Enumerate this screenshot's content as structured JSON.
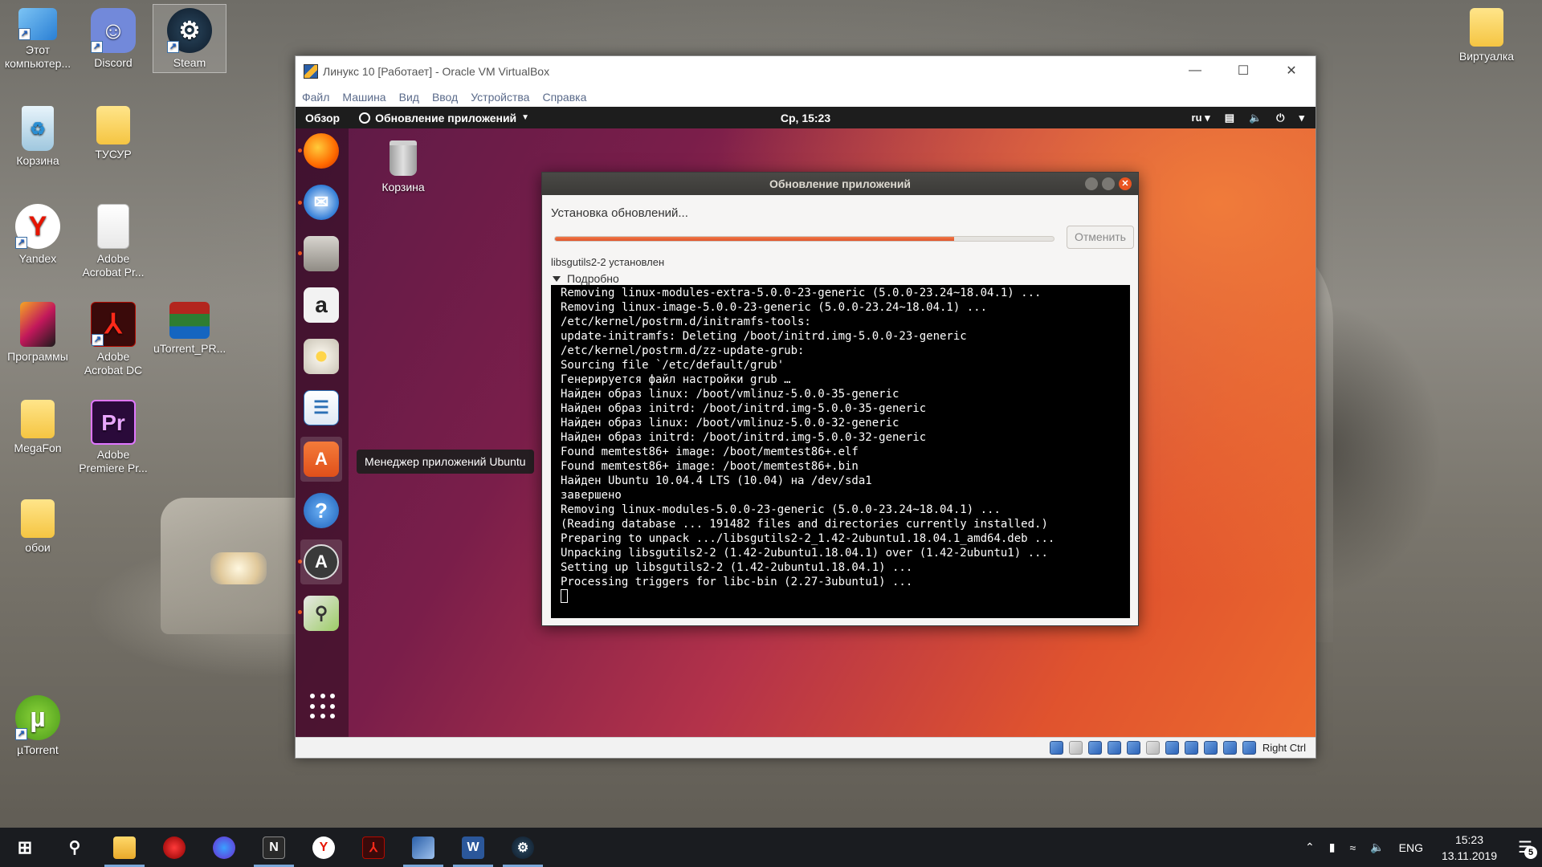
{
  "desktop": {
    "icons": [
      {
        "label": "Этот компьютер...",
        "icon": "computer-icon"
      },
      {
        "label": "Discord",
        "icon": "discord-icon"
      },
      {
        "label": "Steam",
        "icon": "steam-icon"
      },
      {
        "label": "Корзина",
        "icon": "recycle-bin-icon"
      },
      {
        "label": "ТУСУР",
        "icon": "folder-icon"
      },
      {
        "label": "Yandex",
        "icon": "yandex-browser-icon"
      },
      {
        "label": "Adobe Acrobat Pr...",
        "icon": "file-icon"
      },
      {
        "label": "Программы",
        "icon": "programs-icon"
      },
      {
        "label": "Adobe Acrobat DC",
        "icon": "acrobat-icon"
      },
      {
        "label": "uTorrent_PR...",
        "icon": "winrar-icon"
      },
      {
        "label": "MegaFon",
        "icon": "folder-icon"
      },
      {
        "label": "Adobe Premiere Pr...",
        "icon": "premiere-icon"
      },
      {
        "label": "обои",
        "icon": "folder-icon"
      },
      {
        "label": "µTorrent",
        "icon": "utorrent-icon"
      },
      {
        "label": "Виртуалка",
        "icon": "folder-icon"
      }
    ]
  },
  "vbox": {
    "title": "Линукс 10 [Работает] - Oracle VM VirtualBox",
    "menu": [
      "Файл",
      "Машина",
      "Вид",
      "Ввод",
      "Устройства",
      "Справка"
    ],
    "host_key": "Right Ctrl"
  },
  "ubuntu": {
    "topbar": {
      "overview": "Обзор",
      "app_menu": "Обновление приложений",
      "clock": "Ср, 15:23",
      "lang": "ru"
    },
    "trash_label": "Корзина",
    "tooltip": "Менеджер приложений Ubuntu",
    "dock_items": [
      "firefox-icon",
      "thunderbird-icon",
      "files-icon",
      "amazon-icon",
      "rhythmbox-icon",
      "writer-icon",
      "software-center-icon",
      "help-icon",
      "software-updater-icon",
      "image-viewer-icon"
    ]
  },
  "dialog": {
    "title": "Обновление приложений",
    "status": "Установка обновлений...",
    "progress": 0.8,
    "cancel_label": "Отменить",
    "package_status": "libsgutils2-2 установлен",
    "details_label": "Подробно",
    "terminal_lines": [
      "Removing linux-modules-extra-5.0.0-23-generic (5.0.0-23.24~18.04.1) ...",
      "Removing linux-image-5.0.0-23-generic (5.0.0-23.24~18.04.1) ...",
      "/etc/kernel/postrm.d/initramfs-tools:",
      "update-initramfs: Deleting /boot/initrd.img-5.0.0-23-generic",
      "/etc/kernel/postrm.d/zz-update-grub:",
      "Sourcing file `/etc/default/grub'",
      "Генерируется файл настройки grub …",
      "Найден образ linux: /boot/vmlinuz-5.0.0-35-generic",
      "Найден образ initrd: /boot/initrd.img-5.0.0-35-generic",
      "Найден образ linux: /boot/vmlinuz-5.0.0-32-generic",
      "Найден образ initrd: /boot/initrd.img-5.0.0-32-generic",
      "Found memtest86+ image: /boot/memtest86+.elf",
      "Found memtest86+ image: /boot/memtest86+.bin",
      "Найден Ubuntu 10.04.4 LTS (10.04) на /dev/sda1",
      "завершено",
      "Removing linux-modules-5.0.0-23-generic (5.0.0-23.24~18.04.1) ...",
      "(Reading database ... 191482 files and directories currently installed.)",
      "Preparing to unpack .../libsgutils2-2_1.42-2ubuntu1.18.04.1_amd64.deb ...",
      "Unpacking libsgutils2-2 (1.42-2ubuntu1.18.04.1) over (1.42-2ubuntu1) ...",
      "Setting up libsgutils2-2 (1.42-2ubuntu1.18.04.1) ...",
      "Processing triggers for libc-bin (2.27-3ubuntu1) ..."
    ]
  },
  "taskbar": {
    "items": [
      "start-icon",
      "search-icon",
      "file-explorer-icon",
      "antivirus-icon",
      "app-icon",
      "notion-icon",
      "yandex-browser-icon",
      "acrobat-icon",
      "virtualbox-icon",
      "word-icon",
      "steam-icon"
    ],
    "lang": "ENG",
    "time": "15:23",
    "date": "13.11.2019",
    "notifications": "5"
  }
}
